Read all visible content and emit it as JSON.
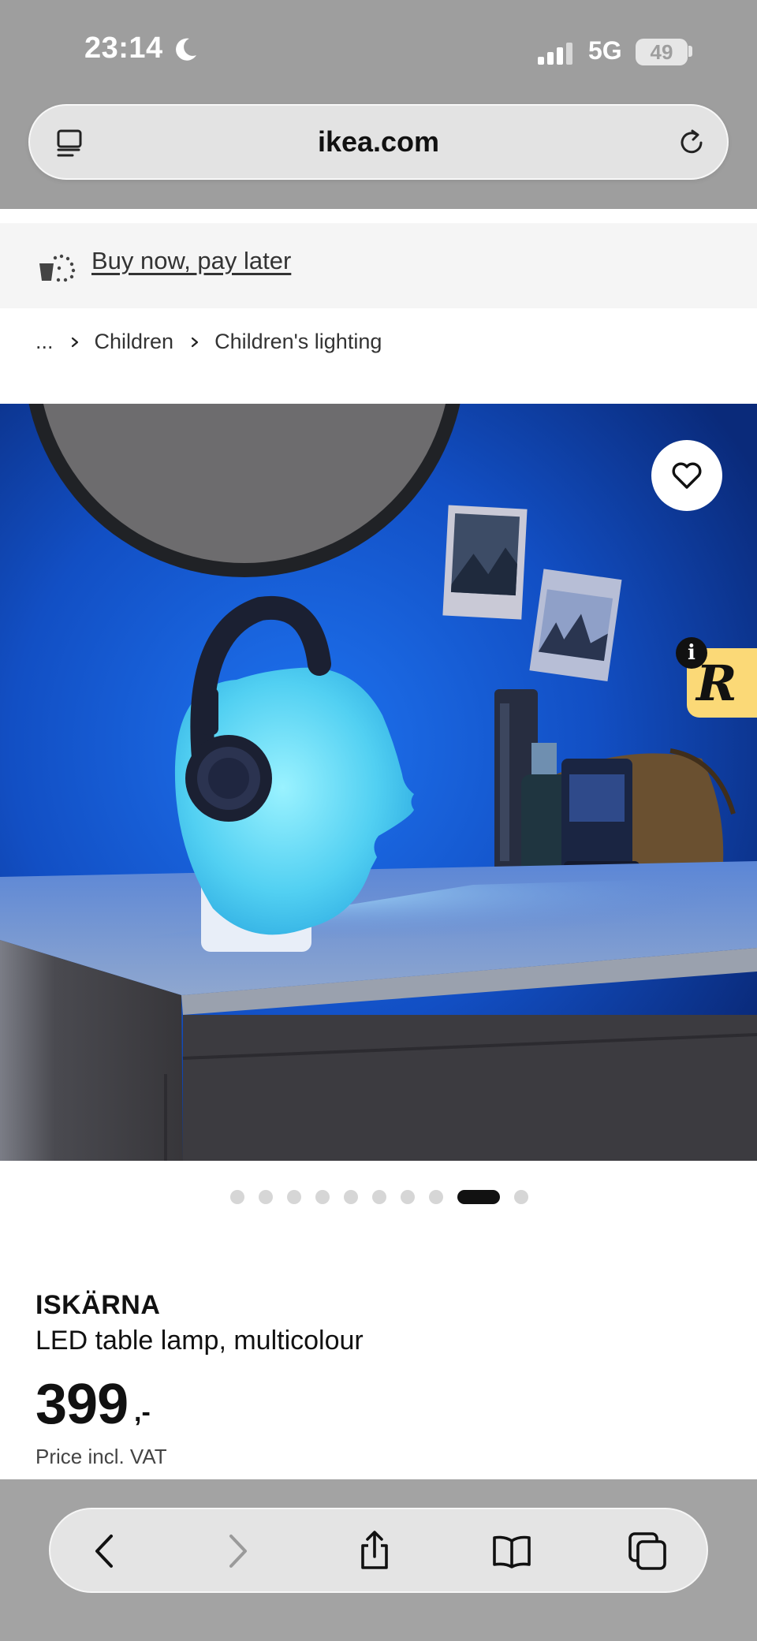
{
  "status_bar": {
    "time": "23:14",
    "network": "5G",
    "battery": "49",
    "icons": [
      "moon-icon",
      "signal-icon",
      "battery-icon"
    ]
  },
  "browser": {
    "url": "ikea.com",
    "icons": [
      "reader-mode-icon",
      "reload-icon"
    ],
    "toolbar_icons": [
      "back-icon",
      "forward-icon",
      "share-icon",
      "bookmarks-icon",
      "tabs-icon"
    ]
  },
  "promo": {
    "label": "Buy now, pay later",
    "icon": "pay-later-icon"
  },
  "breadcrumb": {
    "ellipsis": "...",
    "items": [
      "Children",
      "Children's lighting"
    ]
  },
  "gallery": {
    "image_count": 10,
    "active_index": 8,
    "favourite_icon": "heart-icon",
    "overlay_badge": {
      "letter": "R",
      "info": "i"
    }
  },
  "product": {
    "name": "ISKÄRNA",
    "description": "LED table lamp, multicolour",
    "price": "399",
    "price_suffix": ",-",
    "price_note": "Price incl. VAT"
  },
  "colors": {
    "browser_chrome": "#9e9e9e",
    "promo_background": "#f5f5f5",
    "badge_yellow": "#fbd977",
    "active_dot": "#111111",
    "lamp_glow": "#5fd3f0"
  }
}
